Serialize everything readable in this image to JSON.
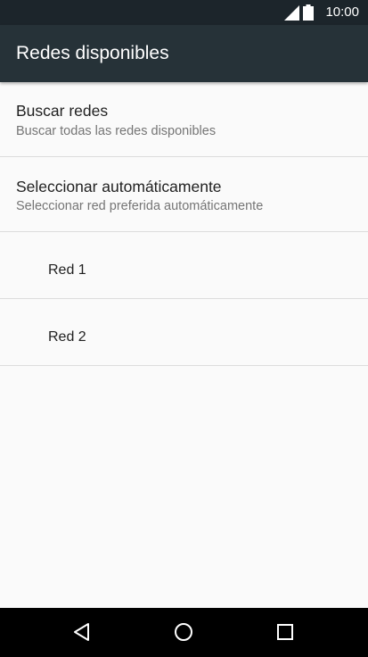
{
  "status_bar": {
    "time": "10:00",
    "icons": [
      "signal-icon",
      "battery-icon"
    ]
  },
  "app_bar": {
    "title": "Redes disponibles"
  },
  "preferences": [
    {
      "title": "Buscar redes",
      "summary": "Buscar todas las redes disponibles"
    },
    {
      "title": "Seleccionar automáticamente",
      "summary": "Seleccionar red preferida automáticamente"
    }
  ],
  "networks": [
    {
      "label": "Red 1"
    },
    {
      "label": "Red 2"
    }
  ],
  "nav_bar": {
    "icons": [
      "back-icon",
      "home-icon",
      "recents-icon"
    ]
  },
  "colors": {
    "status_bar": "#1c252b",
    "app_bar": "#263238",
    "background": "#fafafa",
    "divider": "#dcdcdc",
    "nav_bar": "#000000"
  }
}
